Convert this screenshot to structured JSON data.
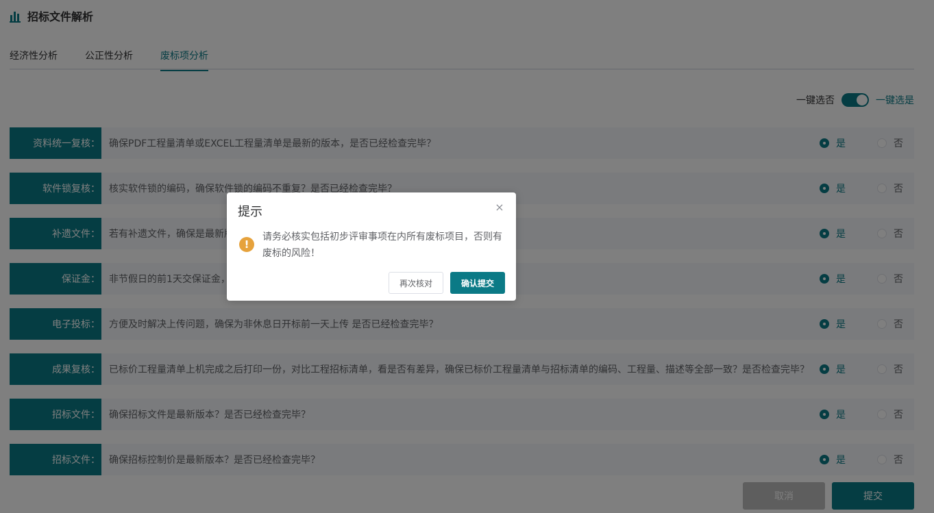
{
  "header": {
    "title": "招标文件解析"
  },
  "tabs": [
    {
      "label": "经济性分析",
      "active": false
    },
    {
      "label": "公正性分析",
      "active": false
    },
    {
      "label": "废标项分析",
      "active": true
    }
  ],
  "toggle": {
    "off_label": "一键选否",
    "on_label": "一键选是",
    "on": true
  },
  "items": [
    {
      "label": "资料统一复核：",
      "text": "确保PDF工程量清单或EXCEL工程量清单是最新的版本，是否已经检查完毕？",
      "yes": "是",
      "no": "否",
      "selected": "yes"
    },
    {
      "label": "软件锁复核：",
      "text": "核实软件锁的编码，确保软件锁的编码不重复？是否已经检查完毕？",
      "yes": "是",
      "no": "否",
      "selected": "yes"
    },
    {
      "label": "补遗文件：",
      "text": "若有补遗文件，确保是最新版",
      "yes": "是",
      "no": "否",
      "selected": "yes"
    },
    {
      "label": "保证金：",
      "text": "非节假日的前1天交保证金，",
      "yes": "是",
      "no": "否",
      "selected": "yes"
    },
    {
      "label": "电子投标：",
      "text": "方便及时解决上传问题，确保为非休息日开标前一天上传 是否已经检查完毕？",
      "yes": "是",
      "no": "否",
      "selected": "yes"
    },
    {
      "label": "成果复核：",
      "text": "已标价工程量清单上机完成之后打印一份，对比工程招标清单，看是否有差异，确保已标价工程量清单与招标清单的编码、工程量、描述等全部一致？是否检查完毕？",
      "yes": "是",
      "no": "否",
      "selected": "yes"
    },
    {
      "label": "招标文件：",
      "text": "确保招标文件是最新版本？是否已经检查完毕？",
      "yes": "是",
      "no": "否",
      "selected": "yes"
    },
    {
      "label": "招标文件：",
      "text": "确保招标控制价是最新版本？是否已经检查完毕？",
      "yes": "是",
      "no": "否",
      "selected": "yes"
    }
  ],
  "footer": {
    "cancel_label": "取消",
    "submit_label": "提交"
  },
  "dialog": {
    "title": "提示",
    "close_glyph": "×",
    "warn_glyph": "!",
    "message": "请务必核实包括初步评审事项在内所有废标项目，否则有废标的风险！",
    "recheck_label": "再次核对",
    "confirm_label": "确认提交"
  },
  "colors": {
    "accent": "#0b7a86",
    "warning": "#e6a23c",
    "cancel_bg": "#bcbcbc"
  }
}
